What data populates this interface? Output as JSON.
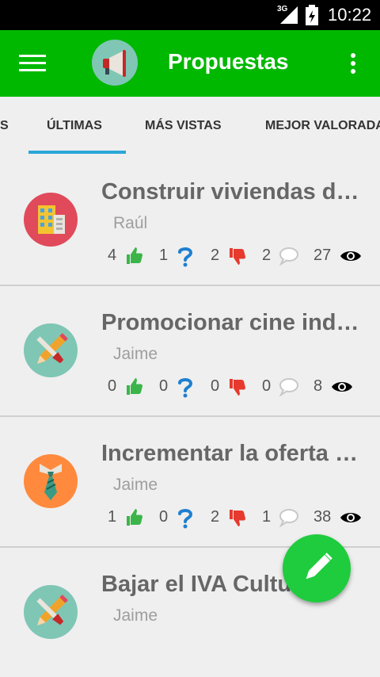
{
  "status_bar": {
    "network": "3G",
    "time": "10:22"
  },
  "app_bar": {
    "title": "Propuestas",
    "menu_icon": "hamburger-menu-icon",
    "logo_icon": "megaphone-icon",
    "overflow_icon": "more-vert-icon"
  },
  "tabs": [
    {
      "label": "S"
    },
    {
      "label": "ÚLTIMAS",
      "selected": true
    },
    {
      "label": "MÁS VISTAS"
    },
    {
      "label": "MEJOR VALORADAS"
    }
  ],
  "proposals": [
    {
      "title": "Construir viviendas de…",
      "author": "Raúl",
      "likes": "4",
      "doubts": "1",
      "dislikes": "2",
      "comments": "2",
      "views": "27",
      "avatar_icon": "building-icon",
      "avatar_color": "#e04a5a"
    },
    {
      "title": "Promocionar cine inde…",
      "author": "Jaime",
      "likes": "0",
      "doubts": "0",
      "dislikes": "0",
      "comments": "0",
      "views": "8",
      "avatar_icon": "pencil-brush-icon",
      "avatar_color": "#7fc6b5"
    },
    {
      "title": "Incrementar la oferta d…",
      "author": "Jaime",
      "likes": "1",
      "doubts": "0",
      "dislikes": "2",
      "comments": "1",
      "views": "38",
      "avatar_icon": "necktie-icon",
      "avatar_color": "#ff8a3d"
    },
    {
      "title": "Bajar el IVA Cultur",
      "author": "Jaime",
      "avatar_icon": "pencil-brush-icon",
      "avatar_color": "#7fc6b5"
    }
  ],
  "fab": {
    "icon": "pencil-icon"
  },
  "colors": {
    "app_bar": "#00b800",
    "tab_indicator": "#2aa6d9",
    "like": "#3bb54a",
    "doubt": "#1e7fd0",
    "dislike": "#e63a2e",
    "fab": "#1ecc3e"
  }
}
